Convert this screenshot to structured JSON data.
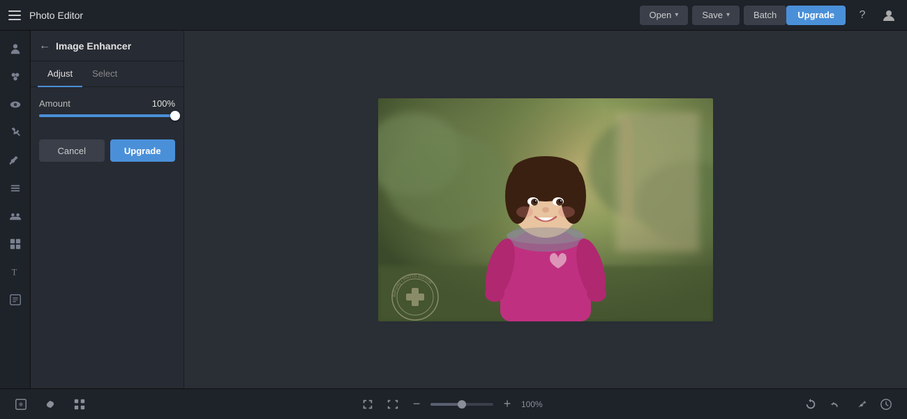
{
  "topbar": {
    "app_title": "Photo Editor",
    "open_label": "Open",
    "save_label": "Save",
    "batch_label": "Batch",
    "upgrade_label": "Upgrade"
  },
  "panel": {
    "back_title": "Image Enhancer",
    "tab_adjust": "Adjust",
    "tab_select": "Select",
    "amount_label": "Amount",
    "amount_value": "100",
    "amount_unit": "%",
    "cancel_label": "Cancel",
    "upgrade_label": "Upgrade"
  },
  "bottombar": {
    "zoom_value": "100",
    "zoom_unit": "%"
  },
  "sidebar": {
    "icons": [
      {
        "name": "person-icon",
        "label": "People"
      },
      {
        "name": "effects-icon",
        "label": "Effects"
      },
      {
        "name": "eye-icon",
        "label": "View"
      },
      {
        "name": "tools-icon",
        "label": "Tools"
      },
      {
        "name": "brush-icon",
        "label": "Brush"
      },
      {
        "name": "layers-icon",
        "label": "Layers"
      },
      {
        "name": "group-icon",
        "label": "Group"
      },
      {
        "name": "shapes-icon",
        "label": "Shapes"
      },
      {
        "name": "text-icon",
        "label": "Text"
      },
      {
        "name": "more-icon",
        "label": "More"
      }
    ]
  }
}
